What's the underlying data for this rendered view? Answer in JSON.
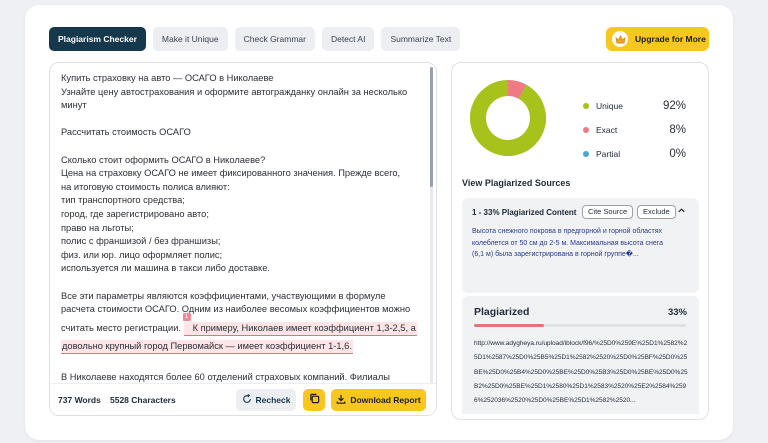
{
  "tabs": [
    {
      "label": "Plagiarism Checker",
      "active": true
    },
    {
      "label": "Make it Unique",
      "active": false
    },
    {
      "label": "Check Grammar",
      "active": false
    },
    {
      "label": "Detect AI",
      "active": false
    },
    {
      "label": "Summarize Text",
      "active": false
    }
  ],
  "upgrade": {
    "label": "Upgrade for More",
    "icon": "crown-icon"
  },
  "editor": {
    "lines": [
      "Купить страховку на авто — ОСАГО в Николаеве",
      "Узнайте цену автострахования и оформите автогражданку онлайн за несколько",
      "минут",
      "",
      "Рассчитать стоимость ОСАГО",
      "",
      "Сколько стоит оформить ОСАГО в Николаеве?",
      "Цена на страховку ОСАГО не имеет фиксированного значения. Прежде всего,",
      "на итоговую стоимость полиса влияют:",
      "тип транспортного средства;",
      "город, где зарегистрировано авто;",
      "право на льготы;",
      "полис с франшизой / без франшизы;",
      "физ. или юр. лицо оформляет полис;",
      "используется ли машина в такси либо доставке.",
      "",
      "Все эти параметры являются коэффициентами, участвующими в формуле",
      "расчета стоимости ОСАГО. Одним из наиболее весомых коэффициентов можно"
    ],
    "pre_highlight": "считать место регистрации.",
    "highlight_1": "К примеру, Николаев имеет коэффициент 1,3-2,5, а",
    "highlight_2": "довольно крупный город Первомайск — имеет коэффициент 1-1,6.",
    "marker": "1",
    "tail_line": "В Николаеве находятся более 60 отделений страховых компаний. Филиалы"
  },
  "footer": {
    "words_value": "737",
    "words_label": "Words",
    "chars_value": "5528",
    "chars_label": "Characters",
    "recheck": "Recheck",
    "download": "Download Report"
  },
  "stats": [
    {
      "label": "Unique",
      "value": "92%",
      "color": "#a6c21b"
    },
    {
      "label": "Exact",
      "value": "8%",
      "color": "#f07a83"
    },
    {
      "label": "Partial",
      "value": "0%",
      "color": "#4aa6d6"
    }
  ],
  "donut": {
    "unique": 92,
    "exact": 8,
    "partial": 0
  },
  "sources": {
    "title": "View Plagiarized Sources",
    "item_head": "1 - 33% Plagiarized Content",
    "cite": "Cite Source",
    "exclude": "Exclude",
    "snippet": "Высота снежного покрова в предгорной и горной областях колеблется от 50 см до 2-5 м. Максимальная высота снега (6,1 м) была зарегистрирована в горной группе�..."
  },
  "plagiarized": {
    "title": "Plagiarized",
    "percent": "33%",
    "fill": 0.33,
    "url": "http://www.adygheya.ru/upload/iblock/f96/%25D0%259E%25D1%2582%25D1%2587%25D0%25B5%25D1%2582%2520%25D0%25BF%25D0%25BE%25D0%25B4%25D0%25BE%25D0%25B3%25D0%25BE%25D0%25B2%25D0%25BE%25D1%2580%25D1%2583%2520%25E2%2584%2596%252036%2520%25D0%25BE%25D1%2582%2520..."
  },
  "colors": {
    "accent": "#f7c71d",
    "dark": "#16384d",
    "highlight": "#e5737c"
  }
}
